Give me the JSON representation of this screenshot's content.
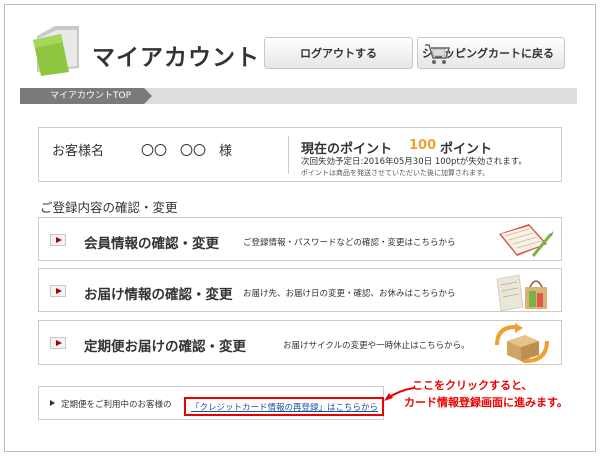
{
  "header": {
    "title": "マイアカウント",
    "logout_label": "ログアウトする",
    "cart_label": "ショッピングカートに戻る"
  },
  "breadcrumb": {
    "current": "マイアカウントTOP"
  },
  "customer": {
    "label": "お客様名",
    "name": "〇〇　〇〇　様"
  },
  "points": {
    "label": "現在のポイント",
    "value": "100",
    "unit": "ポイント",
    "expiry": "次回失効予定日:2016年05月30日 100ptが失効されます。",
    "note": "ポイントは商品を発送させていただいた後に加算されます。"
  },
  "registration": {
    "section_title": "ご登録内容の確認・変更",
    "items": [
      {
        "label": "会員情報の確認・変更",
        "desc": "ご登録情報・パスワードなどの確認・変更はこちらから",
        "icon": "notebook-icon"
      },
      {
        "label": "お届け情報の確認・変更",
        "desc": "お届け先、お届け日の変更・確認、お休みはこちらから",
        "icon": "delivery-bag-icon"
      },
      {
        "label": "定期便お届けの確認・変更",
        "desc": "お届けサイクルの変更や一時休止はこちらから。",
        "icon": "box-cycle-icon"
      }
    ]
  },
  "credit": {
    "prefix": "定期便をご利用中のお客様の",
    "link": "「クレジットカード情報の再登録」はこちらから"
  },
  "callout": {
    "line1": "ここをクリックすると、",
    "line2": "カード情報登録画面に進みます。"
  },
  "colors": {
    "accent_red": "#e00000",
    "points_orange": "#f0a030",
    "link_blue": "#1a4fa0",
    "breadcrumb_gray": "#7a7a7a"
  }
}
